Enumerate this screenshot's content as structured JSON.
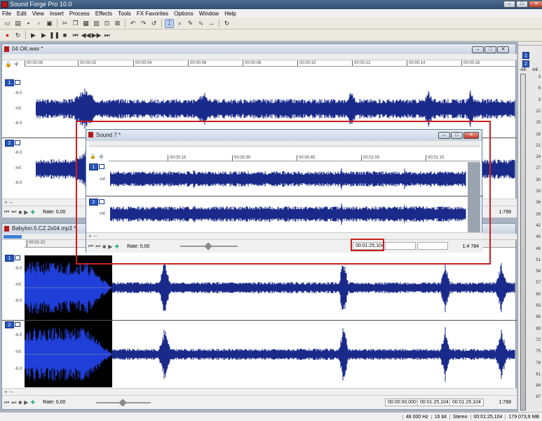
{
  "app": {
    "title": "Sound Forge Pro 10.0"
  },
  "menu": [
    "File",
    "Edit",
    "View",
    "Insert",
    "Process",
    "Effects",
    "Tools",
    "FX Favorites",
    "Options",
    "Window",
    "Help"
  ],
  "toolbar_icons": [
    "new-icon",
    "open-icon",
    "save-icon",
    "save-all-icon",
    "properties-icon",
    "cut-icon",
    "copy-icon",
    "paste-icon",
    "mix-icon",
    "crop-icon",
    "trim-icon",
    "undo-icon",
    "redo-icon",
    "repeat-icon",
    "edit-tool-icon",
    "magnify-tool-icon",
    "pencil-tool-icon",
    "envelope-tool-icon",
    "event-tool-icon",
    "loop-icon"
  ],
  "transport_icons": [
    "record-icon",
    "loop-icon",
    "play-all-icon",
    "play-icon",
    "pause-icon",
    "stop-icon",
    "go-to-start-icon",
    "rewind-icon",
    "forward-icon",
    "go-to-end-icon"
  ],
  "doc1": {
    "title": "04 OK.wav *",
    "ruler": [
      "00:00:00",
      "00:00:02",
      "00:00:04",
      "00:00:06",
      "00:00:08",
      "00:00:10",
      "00:00:12",
      "00:00:14",
      "00:00:16"
    ],
    "db_top": "-6.0",
    "db_mid": "-Inf.",
    "db_bot": "-6.0",
    "ch1": "1",
    "ch2": "2",
    "rate_label": "Rate: 0,00",
    "zoom": "1:768"
  },
  "doc2": {
    "title": "Sound 7 *",
    "ruler": [
      "00:00:15",
      "00:00:30",
      "00:00:45",
      "00:01:00",
      "00:01:15"
    ],
    "db": "-Inf.",
    "ch1": "1",
    "ch2": "2",
    "rate_label": "Rate: 0,00",
    "time": "00:01:25,104",
    "zoom": "1:4 784"
  },
  "doc3": {
    "title": "Babylon.5.CZ.2x04.mp3 *",
    "ruler": [
      "00:01:22"
    ],
    "db_top": "-6.0",
    "db_mid": "-Inf.",
    "db_bot": "-6.0",
    "ch1": "1",
    "ch2": "2",
    "rate_label": "Rate: 0,00",
    "sel_start": "00:00:00,000",
    "sel_end": "00:01:25,104",
    "sel_len": "00:01:25,104",
    "zoom": "1:768"
  },
  "status": {
    "sample_rate": "48 000 Hz",
    "bit_depth": "16 bit",
    "channels": "Stereo",
    "length": "00:01:25,104",
    "free_space": "179 073,9 MB"
  },
  "meter": {
    "ch1": "1",
    "ch2": "2",
    "inf_label": "-Inf.",
    "scale": [
      "3",
      "6",
      "9",
      "12",
      "15",
      "18",
      "21",
      "24",
      "27",
      "30",
      "33",
      "36",
      "39",
      "42",
      "45",
      "48",
      "51",
      "54",
      "57",
      "60",
      "63",
      "66",
      "69",
      "72",
      "75",
      "78",
      "81",
      "84",
      "87"
    ]
  }
}
